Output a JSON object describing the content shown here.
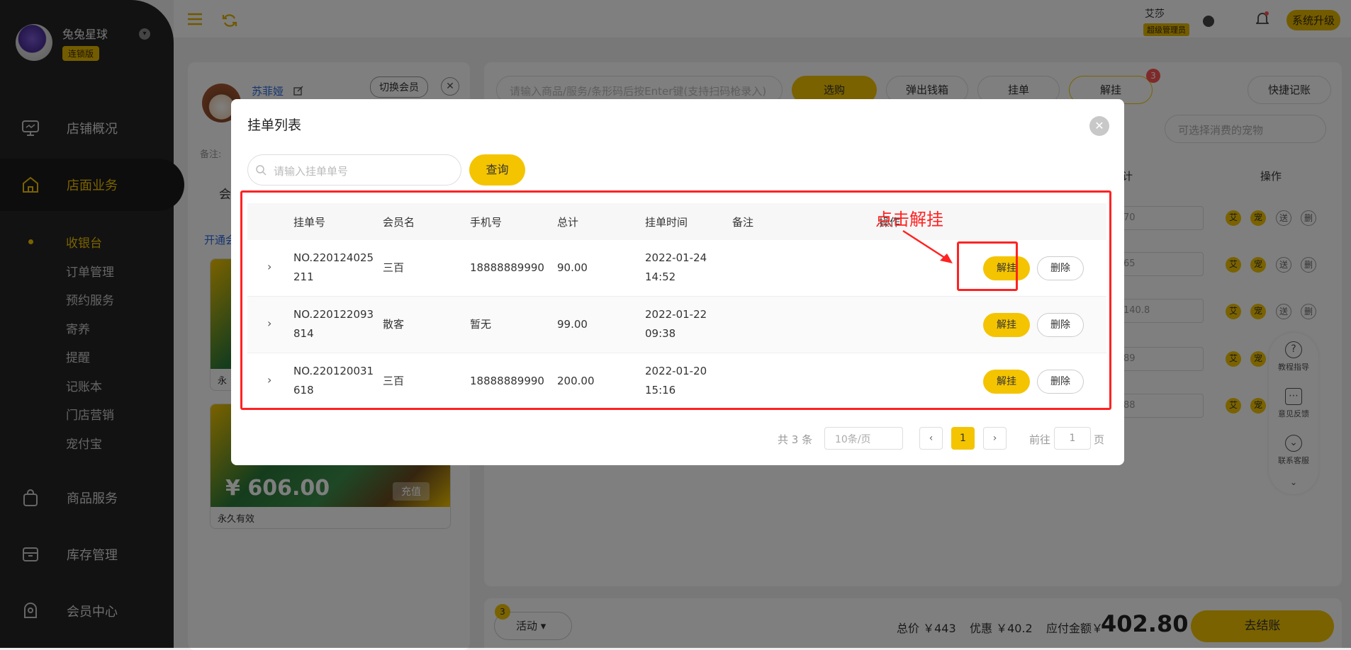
{
  "brand": {
    "name": "兔兔星球",
    "edition": "连锁版"
  },
  "nav": {
    "items": [
      {
        "label": "店铺概况"
      },
      {
        "label": "店面业务"
      },
      {
        "label": "商品服务"
      },
      {
        "label": "库存管理"
      },
      {
        "label": "会员中心"
      }
    ],
    "sub_items": [
      "收银台",
      "订单管理",
      "预约服务",
      "寄养",
      "提醒",
      "记账本",
      "门店营销",
      "宠付宝"
    ]
  },
  "topbar": {
    "user_name": "艾莎",
    "user_role": "超级管理员",
    "upgrade": "系统升级"
  },
  "member": {
    "name": "苏菲娅",
    "switch_label": "切换会员",
    "remark_label": "备注:",
    "open_link": "开通会",
    "tab_label": "会",
    "cards": [
      {
        "amount": "",
        "validity": "永"
      },
      {
        "amount": "¥ 606.00",
        "validity": "永久有效",
        "recharge": "充值"
      }
    ]
  },
  "cashier": {
    "search_placeholder": "请输入商品/服务/条形码后按Enter键(支持扫码枪录入)",
    "buttons": [
      "选购",
      "弹出钱箱",
      "挂单",
      "解挂",
      "快捷记账"
    ],
    "hang_count": "3",
    "pet_placeholder": "可选择消费的宠物",
    "col_total": "计",
    "col_op": "操作",
    "row_values": [
      "70",
      "65",
      "140.8",
      "89",
      "88"
    ],
    "chips": [
      "艾",
      "宠",
      "送",
      "删"
    ]
  },
  "float_panel": {
    "items": [
      "教程指导",
      "意见反馈",
      "联系客服"
    ]
  },
  "bottom": {
    "activity_label": "活动",
    "activity_count": "3",
    "total": "总价 ￥443",
    "discount": "优惠 ￥40.2",
    "payable_label": "应付金额￥",
    "payable": "402.80",
    "checkout": "去结账"
  },
  "modal": {
    "title": "挂单列表",
    "search_placeholder": "请输入挂单单号",
    "query_label": "查询",
    "columns": [
      "挂单号",
      "会员名",
      "手机号",
      "总计",
      "挂单时间",
      "备注",
      "操作"
    ],
    "rows": [
      {
        "no": "NO.220124025211",
        "member": "三百",
        "phone": "18888889990",
        "total": "90.00",
        "time": "2022-01-24 14:52",
        "remark": ""
      },
      {
        "no": "NO.220122093814",
        "member": "散客",
        "phone": "暂无",
        "total": "99.00",
        "time": "2022-01-22 09:38",
        "remark": ""
      },
      {
        "no": "NO.220120031618",
        "member": "三百",
        "phone": "18888889990",
        "total": "200.00",
        "time": "2022-01-20 15:16",
        "remark": ""
      }
    ],
    "unhang_label": "解挂",
    "delete_label": "删除",
    "annotation": "点击解挂",
    "pager": {
      "total_text": "共 3 条",
      "page_size": "10条/页",
      "current_page": "1",
      "goto_prefix": "前往",
      "goto_value": "1",
      "goto_suffix": "页"
    }
  }
}
